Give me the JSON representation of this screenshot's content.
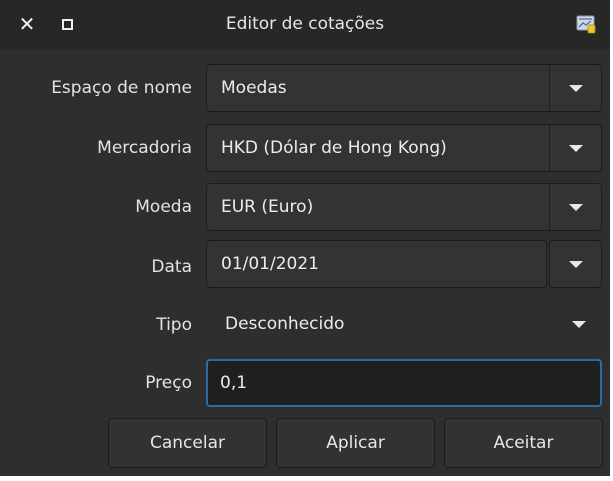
{
  "window": {
    "title": "Editor de cotações",
    "close_icon": "close-icon",
    "maximize_icon": "maximize-icon",
    "app_icon": "app-icon"
  },
  "form": {
    "namespace": {
      "label": "Espaço de nome",
      "value": "Moedas"
    },
    "commodity": {
      "label": "Mercadoria",
      "value": "HKD (Dólar de Hong Kong)"
    },
    "currency": {
      "label": "Moeda",
      "value": "EUR (Euro)"
    },
    "date": {
      "label": "Data",
      "value": "01/01/2021"
    },
    "type": {
      "label": "Tipo",
      "value": "Desconhecido"
    },
    "price": {
      "label": "Preço",
      "value": "0,1"
    }
  },
  "buttons": {
    "cancel": "Cancelar",
    "apply": "Aplicar",
    "accept": "Aceitar"
  },
  "colors": {
    "background": "#2e2e2e",
    "titlebar": "#272727",
    "focus_border": "#2f6aa5"
  }
}
